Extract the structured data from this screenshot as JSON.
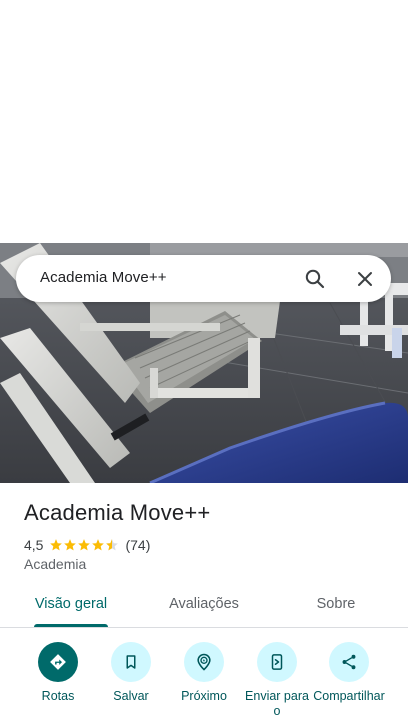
{
  "search": {
    "query": "Academia Move++"
  },
  "place": {
    "name": "Academia Move++",
    "rating": "4,5",
    "rating_value": 4.5,
    "reviews_count": "(74)",
    "category": "Academia"
  },
  "tabs": [
    {
      "label": "Visão geral",
      "active": true
    },
    {
      "label": "Avaliações",
      "active": false
    },
    {
      "label": "Sobre",
      "active": false
    }
  ],
  "actions": [
    {
      "label": "Rotas",
      "icon": "directions-icon"
    },
    {
      "label": "Salvar",
      "icon": "bookmark-icon"
    },
    {
      "label": "Próximo",
      "icon": "nearby-icon"
    },
    {
      "label": "Enviar para o",
      "icon": "send-to-phone-icon"
    },
    {
      "label": "Compartilhar",
      "icon": "share-icon"
    }
  ],
  "colors": {
    "accent": "#006a6a",
    "action_bg": "#d0f8ff",
    "star": "#fbbc04",
    "text_primary": "#202124",
    "text_secondary": "#5f6368"
  }
}
